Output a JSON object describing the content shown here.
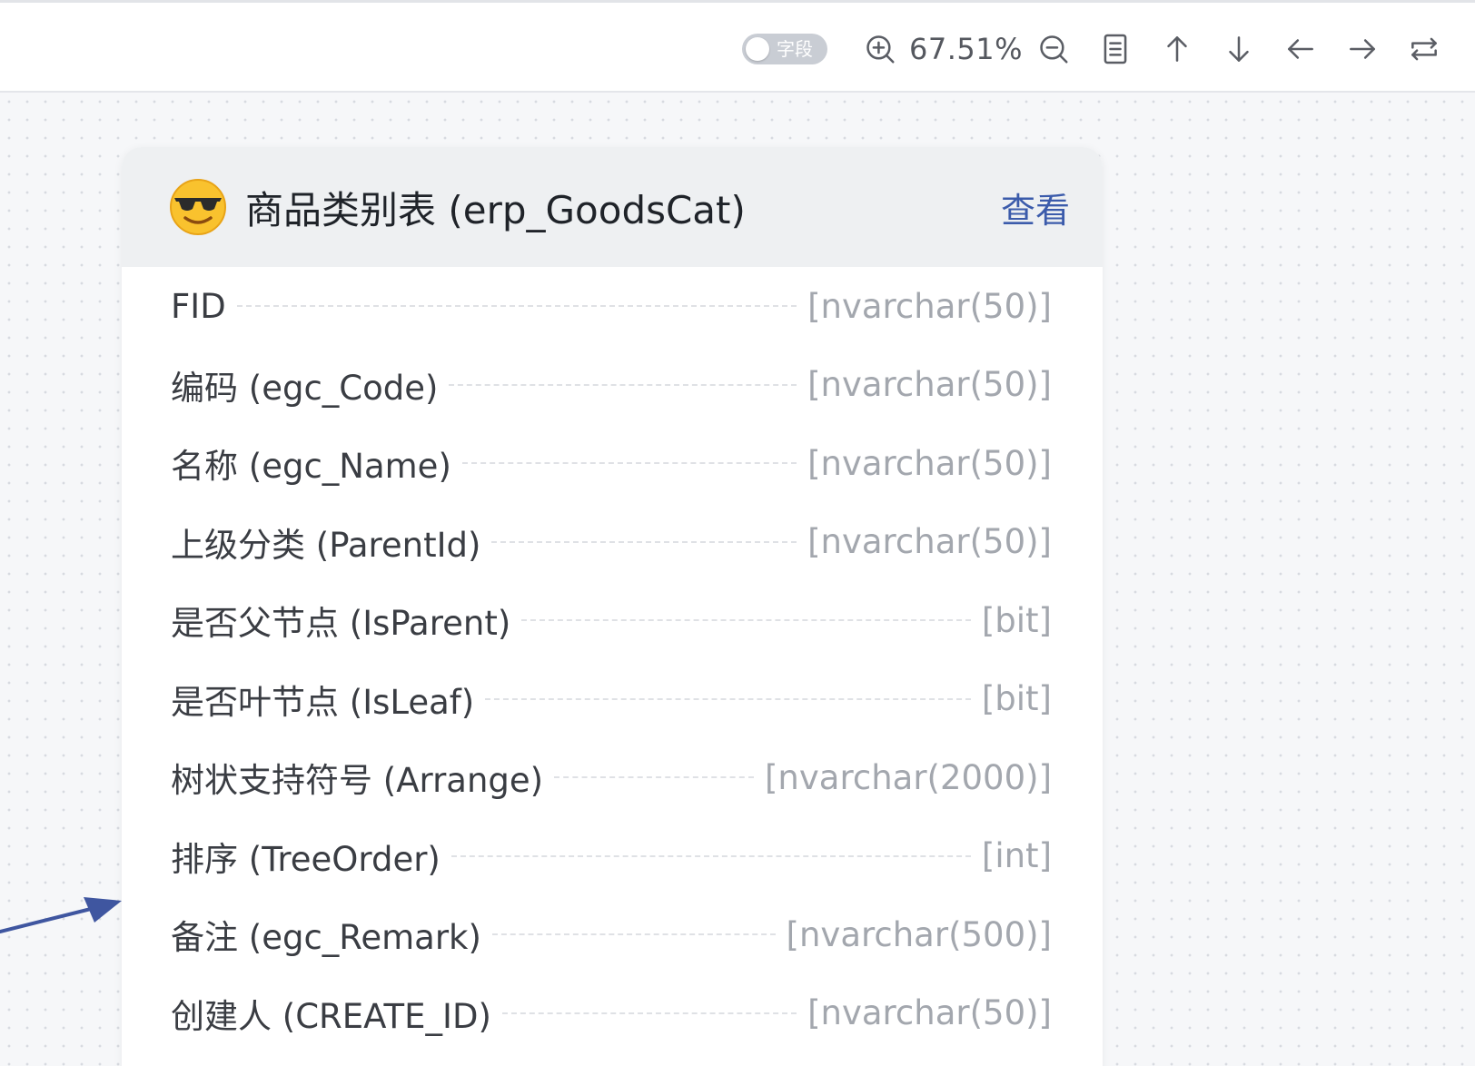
{
  "toolbar": {
    "toggle_label": "字段",
    "zoom_level": "67.51%"
  },
  "table": {
    "title": "商品类别表 (erp_GoodsCat)",
    "view_label": "查看",
    "fields": [
      {
        "name": "FID",
        "type": "[nvarchar(50)]"
      },
      {
        "name": "编码 (egc_Code)",
        "type": "[nvarchar(50)]"
      },
      {
        "name": "名称 (egc_Name)",
        "type": "[nvarchar(50)]"
      },
      {
        "name": "上级分类 (ParentId)",
        "type": "[nvarchar(50)]"
      },
      {
        "name": "是否父节点 (IsParent)",
        "type": "[bit]"
      },
      {
        "name": "是否叶节点 (IsLeaf)",
        "type": "[bit]"
      },
      {
        "name": "树状支持符号 (Arrange)",
        "type": "[nvarchar(2000)]"
      },
      {
        "name": "排序 (TreeOrder)",
        "type": "[int]"
      },
      {
        "name": "备注 (egc_Remark)",
        "type": "[nvarchar(500)]"
      },
      {
        "name": "创建人 (CREATE_ID)",
        "type": "[nvarchar(50)]"
      }
    ]
  },
  "colors": {
    "link": "#3b5bab",
    "arrow": "#3f56a0"
  },
  "icons": [
    "zoom-in-icon",
    "zoom-out-icon",
    "document-icon",
    "arrow-up-icon",
    "arrow-down-icon",
    "arrow-left-icon",
    "arrow-right-icon",
    "swap-icon",
    "sunglasses-emoji-icon"
  ]
}
